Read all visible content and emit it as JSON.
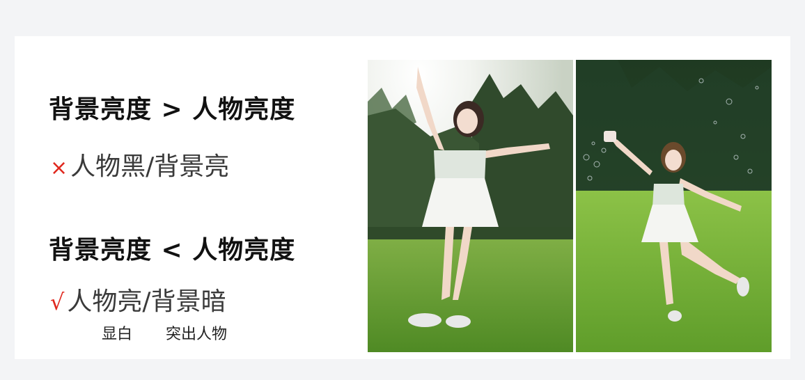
{
  "slide": {
    "rule1": {
      "heading": "背景亮度 > 人物亮度",
      "mark": "×",
      "text": "人物黑/背景亮"
    },
    "rule2": {
      "heading": "背景亮度 < 人物亮度",
      "mark": "√",
      "text": "人物亮/背景暗"
    },
    "tags": [
      "显白",
      "突出人物"
    ]
  },
  "colors": {
    "mark": "#e0281e",
    "grass": "#6fae2e",
    "trees": "#2f4a2a"
  }
}
